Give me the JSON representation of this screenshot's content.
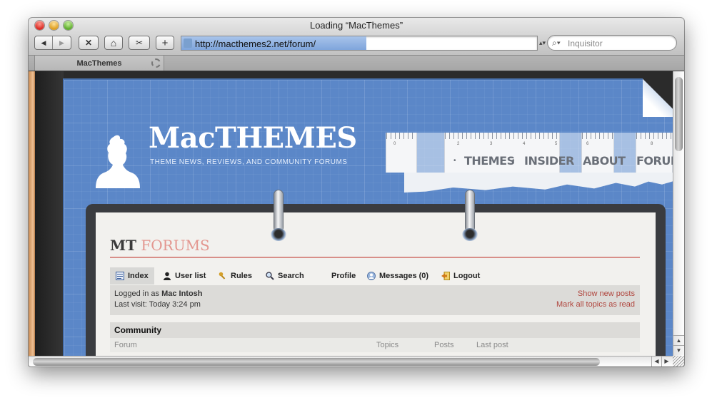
{
  "window": {
    "title": "Loading “MacThemes”"
  },
  "toolbar": {
    "back_glyph": "◀",
    "forward_glyph": "▶",
    "stop_glyph": "✕",
    "home_glyph": "⌂",
    "snippet_glyph": "✂",
    "add_glyph": "+",
    "url": "http://macthemes2.net/forum/",
    "load_progress": 0.52,
    "search_placeholder": "Inquisitor"
  },
  "tabs": [
    {
      "label": "MacThemes",
      "loading": true
    }
  ],
  "site": {
    "logo_title": "MacTHEMES",
    "logo_subtitle": "THEME NEWS, REVIEWS, AND COMMUNITY FORUMS",
    "ruler_numbers": [
      "0",
      "2",
      "3",
      "4",
      "5",
      "6",
      "8"
    ],
    "nav": [
      {
        "label": "THEMES"
      },
      {
        "label": "INSIDER"
      },
      {
        "label": "ABOUT"
      },
      {
        "label": "FORUM"
      }
    ]
  },
  "forum": {
    "logo_mt": "MT",
    "logo_forums": "FORUMS",
    "nav": {
      "index": "Index",
      "user_list": "User list",
      "rules": "Rules",
      "search": "Search",
      "profile": "Profile",
      "messages": "Messages (0)",
      "logout": "Logout"
    },
    "login": {
      "logged_in_prefix": "Logged in as ",
      "username": "Mac Intosh",
      "last_visit": "Last visit: Today 3:24 pm",
      "show_new_posts": "Show new posts",
      "mark_all_read": "Mark all topics as read"
    },
    "category": {
      "title": "Community",
      "columns": {
        "forum": "Forum",
        "topics": "Topics",
        "posts": "Posts",
        "last_post": "Last post"
      }
    }
  },
  "colors": {
    "site_blue": "#5b87c8",
    "forum_accent": "#e3968f",
    "link_red": "#b0463e"
  }
}
